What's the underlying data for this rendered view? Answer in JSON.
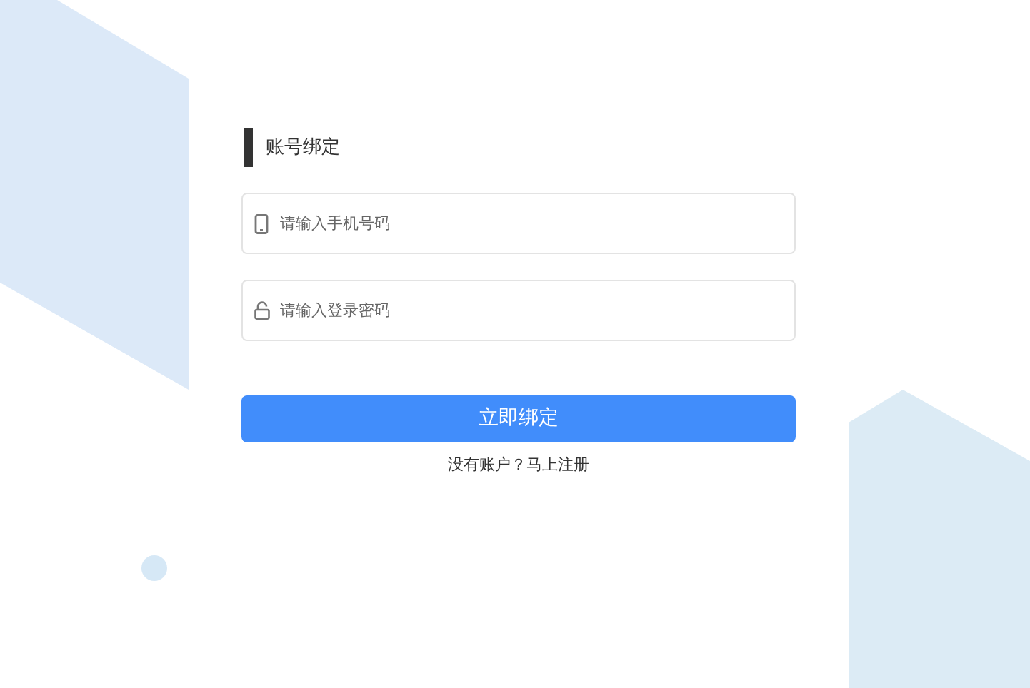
{
  "title": "账号绑定",
  "fields": [
    {
      "kind": "phone",
      "placeholder": "请输入手机号码"
    },
    {
      "kind": "password",
      "placeholder": "请输入登录密码"
    }
  ],
  "submit_button": "立即绑定",
  "register_link": "没有账户？马上注册"
}
